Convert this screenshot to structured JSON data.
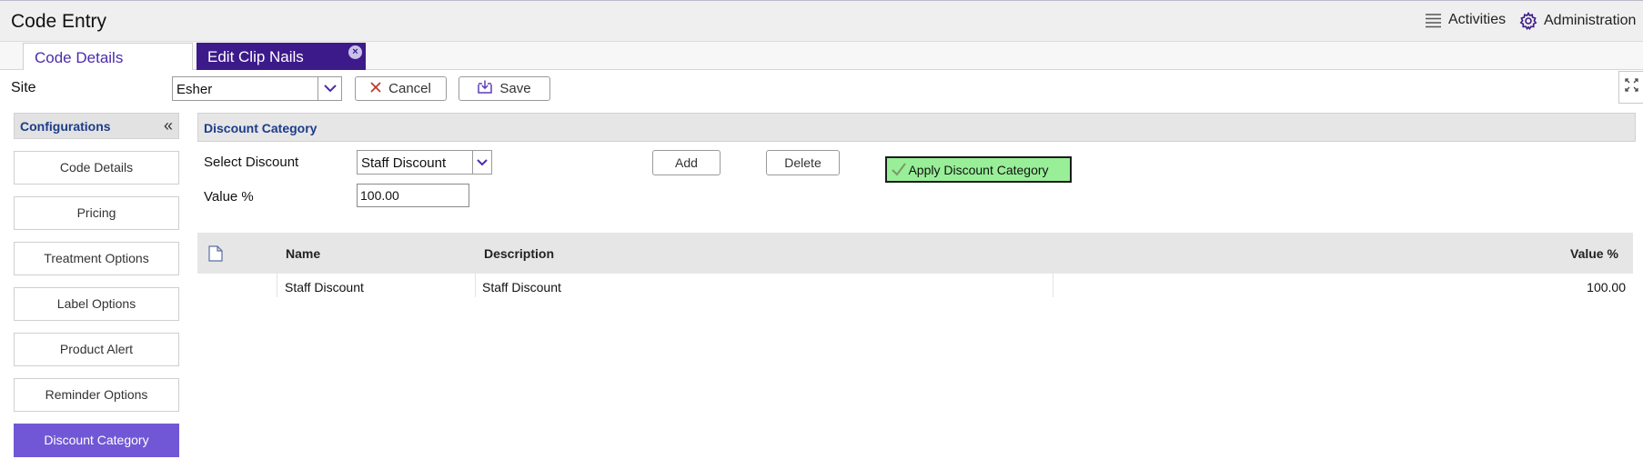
{
  "app": {
    "title": "Code Entry"
  },
  "header": {
    "activities_label": "Activities",
    "administration_label": "Administration"
  },
  "tabs": [
    {
      "label": "Code Details",
      "active": false
    },
    {
      "label": "Edit Clip Nails",
      "active": true,
      "closable": true
    }
  ],
  "toolbar": {
    "site_label": "Site",
    "site_value": "Esher",
    "cancel_label": "Cancel",
    "save_label": "Save"
  },
  "sidebar": {
    "title": "Configurations",
    "collapse_glyph": "«",
    "items": [
      {
        "label": "Code Details"
      },
      {
        "label": "Pricing"
      },
      {
        "label": "Treatment Options"
      },
      {
        "label": "Label Options"
      },
      {
        "label": "Product Alert"
      },
      {
        "label": "Reminder Options"
      },
      {
        "label": "Discount Category",
        "active": true
      }
    ]
  },
  "panel": {
    "title": "Discount Category",
    "select_discount_label": "Select Discount",
    "select_discount_value": "Staff Discount",
    "value_label": "Value %",
    "value_input": "100.00",
    "add_label": "Add",
    "delete_label": "Delete",
    "apply_label": "Apply Discount Category"
  },
  "grid": {
    "columns": [
      "Name",
      "Description",
      "Value %"
    ],
    "rows": [
      {
        "name": "Staff Discount",
        "description": "Staff Discount",
        "value": "100.00"
      }
    ]
  },
  "colors": {
    "accent": "#3d1a8a",
    "sidebar_active": "#7157d5",
    "apply_button": "#98ef98",
    "section_title": "#1c3d8a"
  }
}
